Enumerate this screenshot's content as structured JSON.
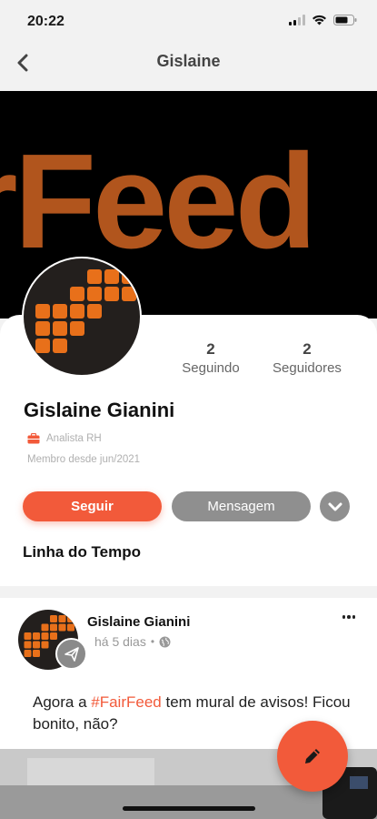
{
  "status_bar": {
    "time": "20:22"
  },
  "nav": {
    "title": "Gislaine"
  },
  "cover": {
    "brand_text": "rFeed"
  },
  "profile": {
    "name": "Gislaine Gianini",
    "role": "Analista RH",
    "member_since": "Membro desde jun/2021",
    "stats": [
      {
        "count": "2",
        "label": "Seguindo"
      },
      {
        "count": "2",
        "label": "Seguidores"
      }
    ]
  },
  "actions": {
    "follow_label": "Seguir",
    "message_label": "Mensagem"
  },
  "timeline": {
    "title": "Linha do Tempo"
  },
  "post": {
    "author": "Gislaine Gianini",
    "time": "há 5 dias",
    "text_before": "Agora a ",
    "hashtag": "#FairFeed",
    "text_after": " tem mural de avisos! Ficou bonito, não?"
  },
  "colors": {
    "accent": "#f25a3a",
    "secondary_button": "#8f8f8f",
    "brand_orange": "#e8701a",
    "brand_dark": "#231f1d"
  }
}
